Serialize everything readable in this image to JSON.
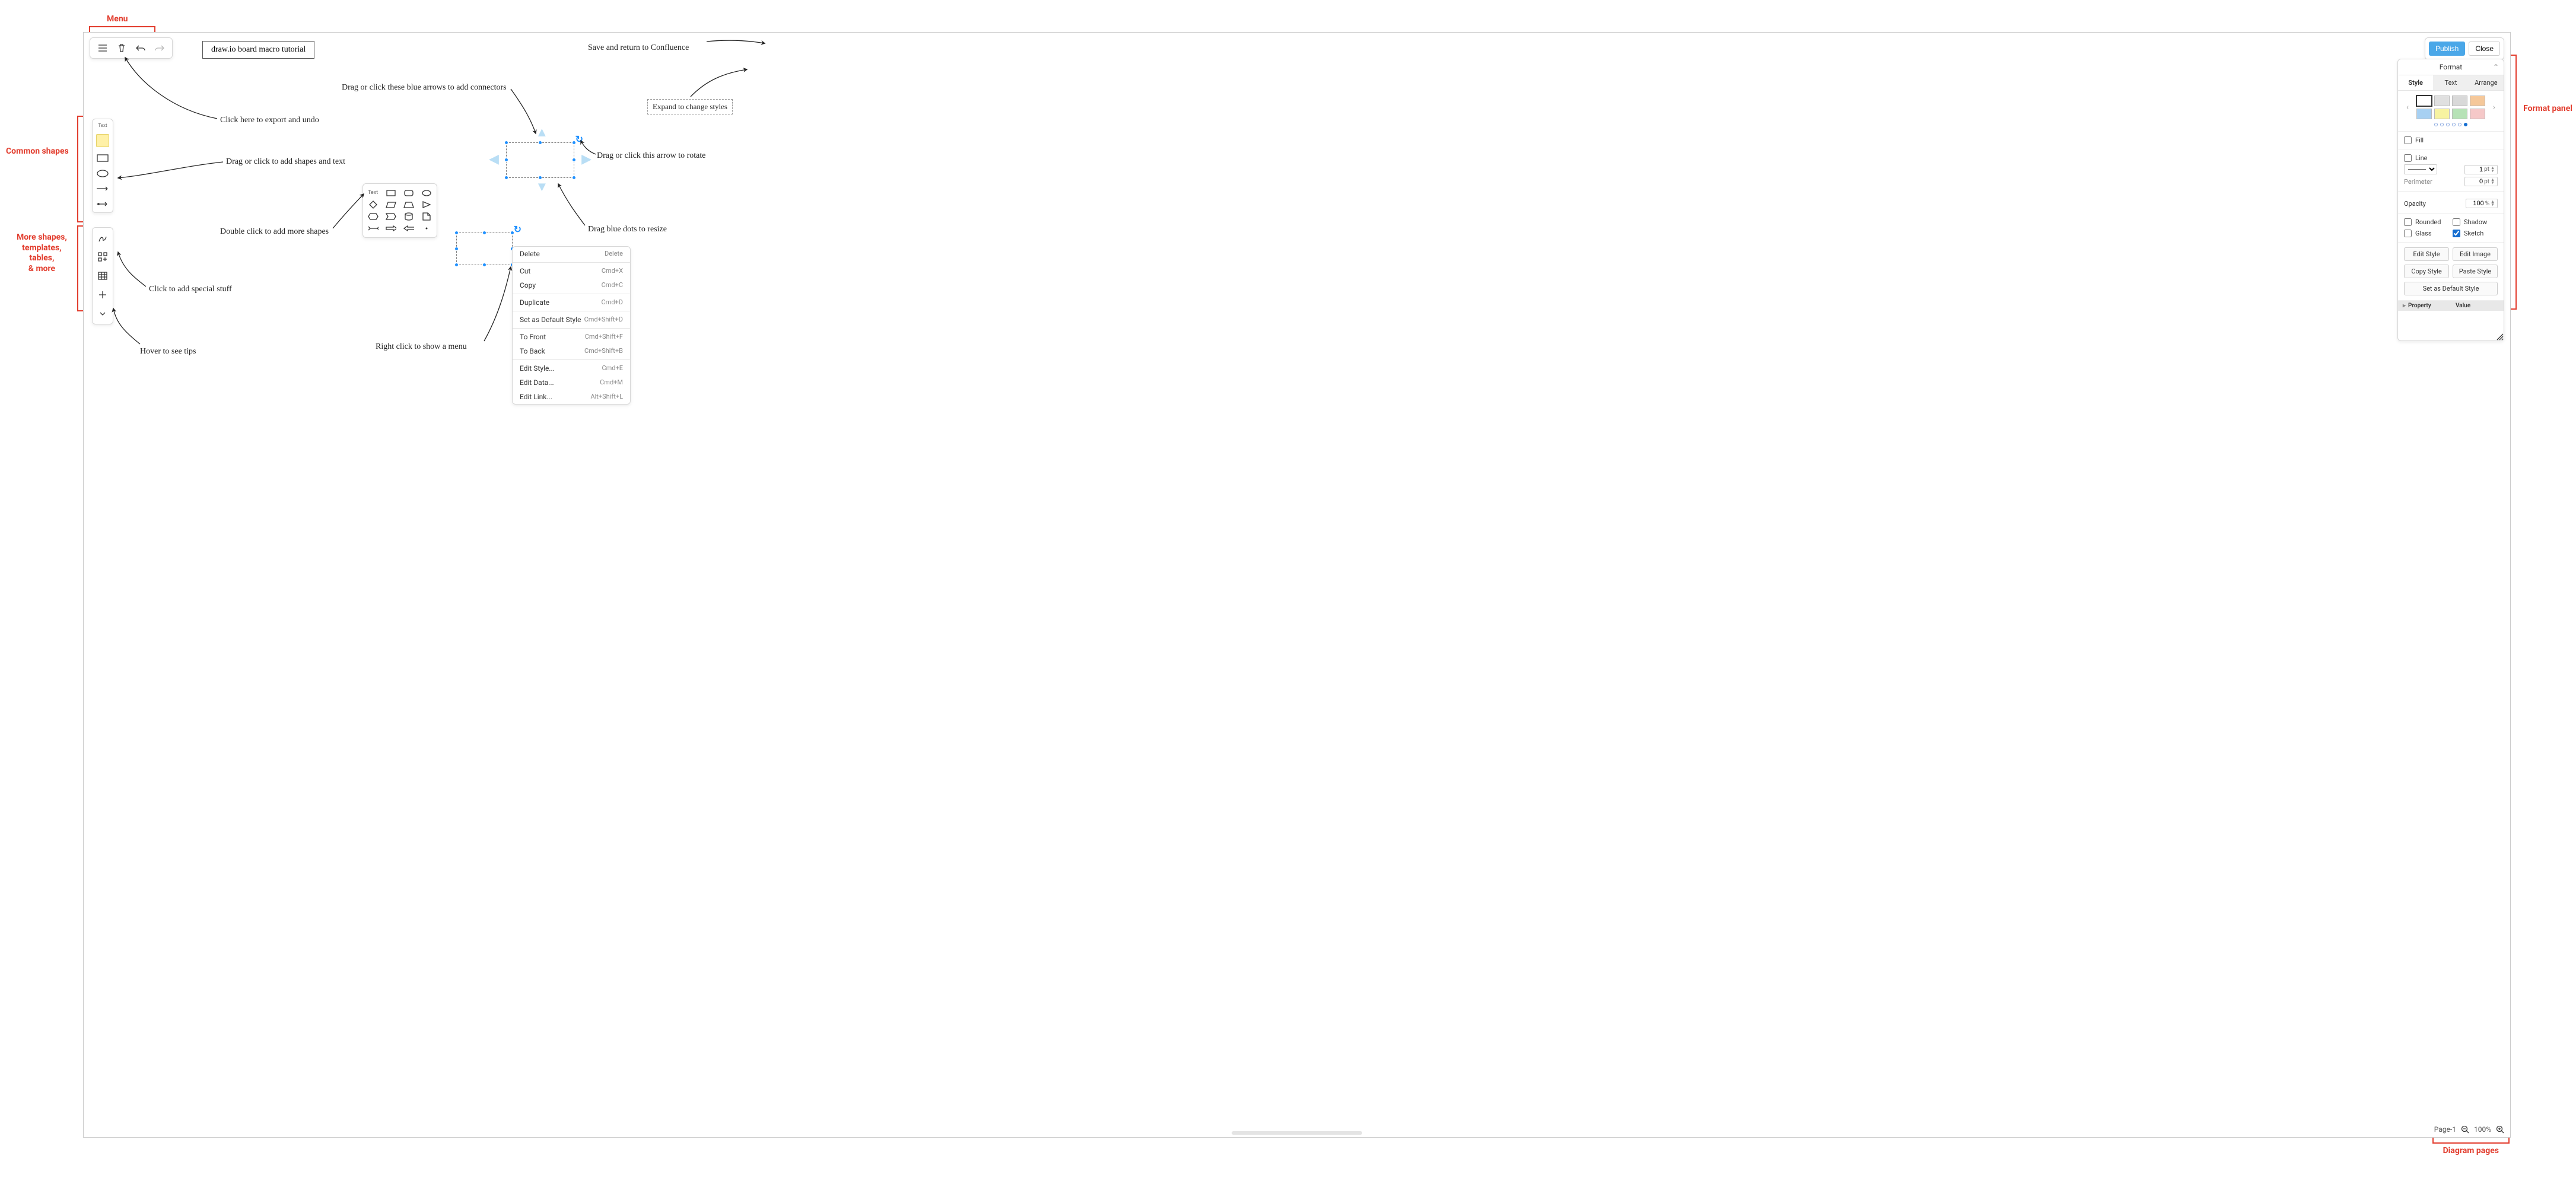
{
  "callouts": {
    "menu": "Menu",
    "common_shapes": "Common shapes",
    "more_shapes_l1": "More shapes,",
    "more_shapes_l2": "templates,",
    "more_shapes_l3": "tables,",
    "more_shapes_l4": "& more",
    "format_panel": "Format panel",
    "diagram_pages": "Diagram pages"
  },
  "title": "draw.io board macro tutorial",
  "notes": {
    "export_undo": "Click here to export and undo",
    "add_shapes_text": "Drag or click to add shapes and text",
    "doubleclick_more": "Double click to add more shapes",
    "special_stuff": "Click to add special stuff",
    "hover_tips": "Hover to see tips",
    "right_click_menu": "Right click to show a menu",
    "blue_arrows_connectors": "Drag or click these blue arrows to add connectors",
    "rotate_arrow": "Drag or click this arrow to rotate",
    "blue_dots_resize": "Drag blue dots to resize",
    "expand_styles": "Expand to change styles",
    "save_return": "Save and return to Confluence"
  },
  "topbar": {
    "publish": "Publish",
    "close": "Close"
  },
  "shapesbar": {
    "text_label": "Text"
  },
  "shapepicker": {
    "text_label": "Text"
  },
  "context_menu": [
    {
      "label": "Delete",
      "kbd": "Delete"
    },
    {
      "sep": true
    },
    {
      "label": "Cut",
      "kbd": "Cmd+X"
    },
    {
      "label": "Copy",
      "kbd": "Cmd+C"
    },
    {
      "sep": true
    },
    {
      "label": "Duplicate",
      "kbd": "Cmd+D"
    },
    {
      "sep": true
    },
    {
      "label": "Set as Default Style",
      "kbd": "Cmd+Shift+D"
    },
    {
      "sep": true
    },
    {
      "label": "To Front",
      "kbd": "Cmd+Shift+F"
    },
    {
      "label": "To Back",
      "kbd": "Cmd+Shift+B"
    },
    {
      "sep": true
    },
    {
      "label": "Edit Style...",
      "kbd": "Cmd+E"
    },
    {
      "label": "Edit Data...",
      "kbd": "Cmd+M"
    },
    {
      "label": "Edit Link...",
      "kbd": "Alt+Shift+L"
    }
  ],
  "format": {
    "header": "Format",
    "tabs": {
      "style": "Style",
      "text": "Text",
      "arrange": "Arrange"
    },
    "palette": {
      "row1": [
        "#ffffff",
        "#e0e0e0",
        "#d9d9d9",
        "#f5c89a"
      ],
      "row2": [
        "#a7d0f2",
        "#f7f3a1",
        "#b6e2b6",
        "#f5c8c8"
      ],
      "selected_index": 0,
      "page_count": 6,
      "page_active": 5
    },
    "fill": {
      "label": "Fill",
      "checked": false
    },
    "line": {
      "label": "Line",
      "checked": false,
      "style_options": [
        "———"
      ],
      "width_value": "1",
      "width_unit": "pt"
    },
    "perimeter": {
      "label": "Perimeter",
      "value": "0",
      "unit": "pt"
    },
    "opacity": {
      "label": "Opacity",
      "value": "100",
      "unit": "%"
    },
    "flags": {
      "rounded": {
        "label": "Rounded",
        "checked": false
      },
      "shadow": {
        "label": "Shadow",
        "checked": false
      },
      "glass": {
        "label": "Glass",
        "checked": false
      },
      "sketch": {
        "label": "Sketch",
        "checked": true
      }
    },
    "buttons": {
      "edit_style": "Edit Style",
      "edit_image": "Edit Image",
      "copy_style": "Copy Style",
      "paste_style": "Paste Style",
      "set_default": "Set as Default Style"
    },
    "props": {
      "col1": "Property",
      "col2": "Value"
    }
  },
  "page": {
    "name": "Page-1",
    "zoom": "100%"
  }
}
